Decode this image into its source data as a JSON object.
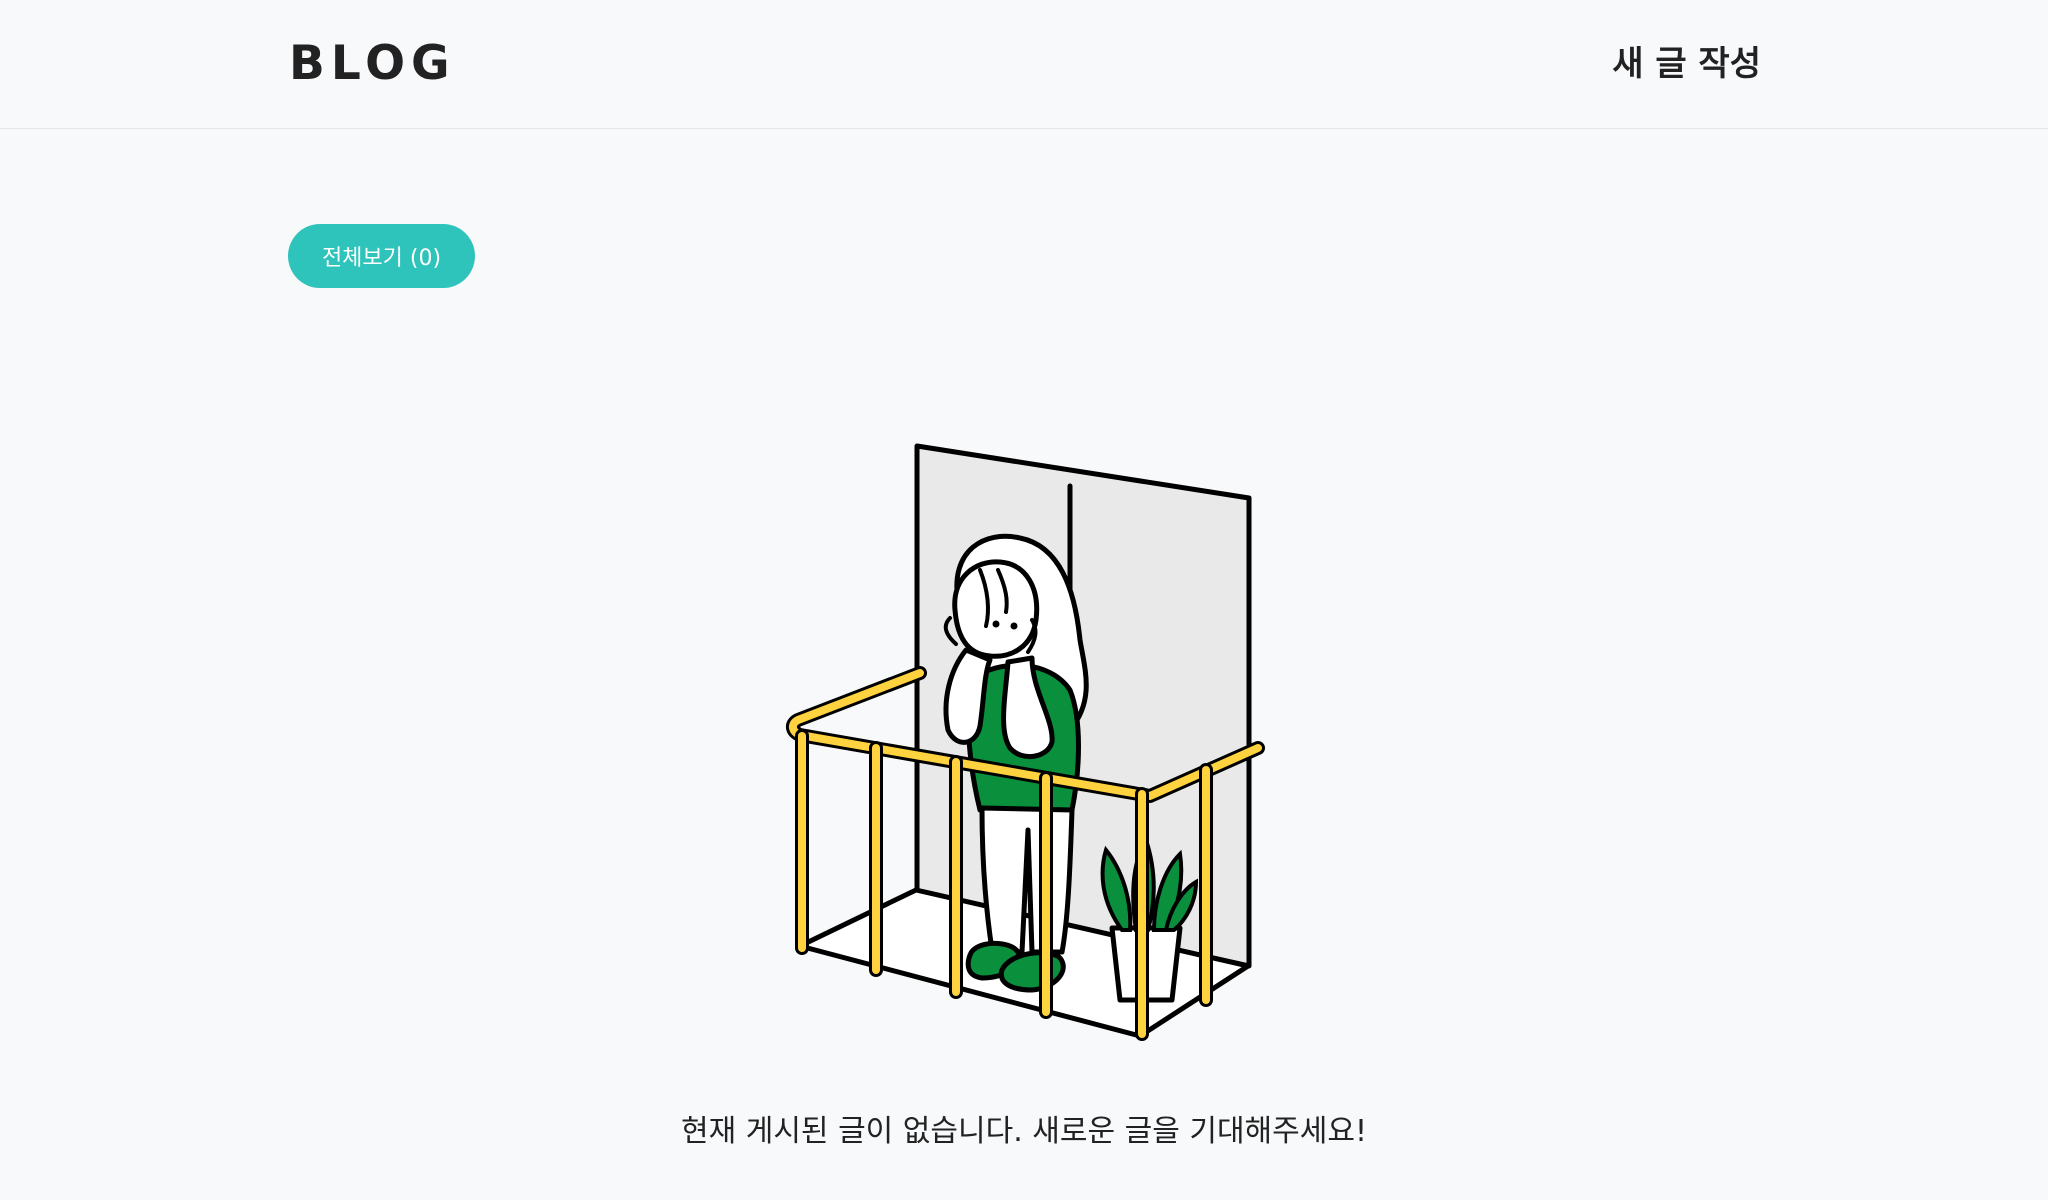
{
  "header": {
    "logo": "BLOG",
    "write_label": "새 글 작성"
  },
  "filter": {
    "all_label": "전체보기 (0)"
  },
  "empty_state": {
    "message": "현재 게시된 글이 없습니다. 새로운 글을 기대해주세요!"
  },
  "colors": {
    "accent": "#2ec4bb",
    "railing": "#ffd23f",
    "plant": "#0a8f3c",
    "wall": "#e9e9e9"
  },
  "icons": {
    "illustration": "person-on-balcony-illustration"
  }
}
